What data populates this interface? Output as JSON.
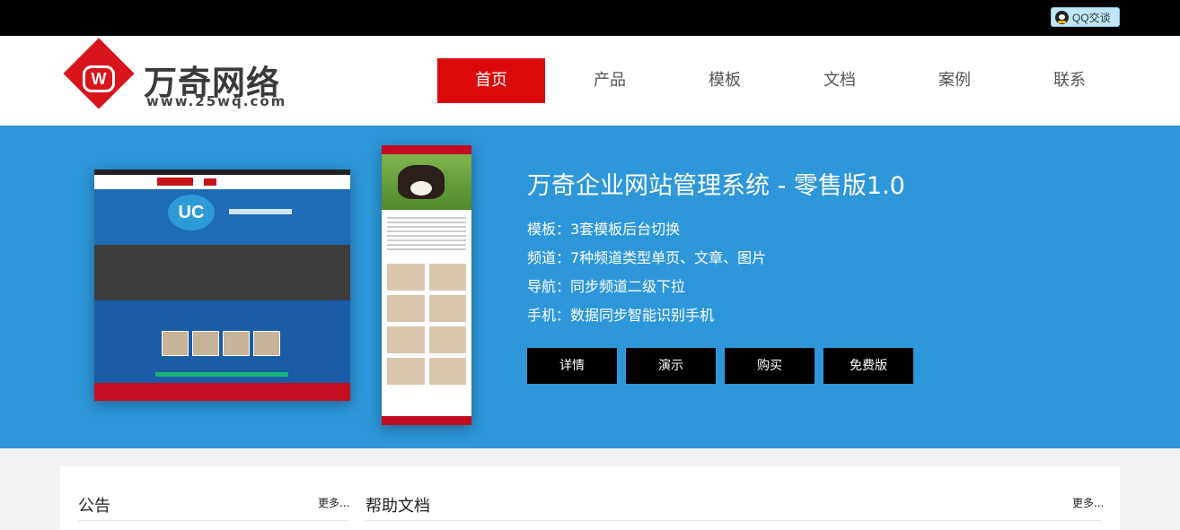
{
  "topbar": {
    "qq_label": "QQ交谈"
  },
  "logo": {
    "mark": "W",
    "title": "万奇网络",
    "url": "www.25wq.com"
  },
  "nav": {
    "items": [
      {
        "label": "首页",
        "active": true
      },
      {
        "label": "产品",
        "active": false
      },
      {
        "label": "模板",
        "active": false
      },
      {
        "label": "文档",
        "active": false
      },
      {
        "label": "案例",
        "active": false
      },
      {
        "label": "联系",
        "active": false
      }
    ]
  },
  "banner": {
    "title": "万奇企业网站管理系统 - 零售版1.0",
    "features": [
      "模板：3套模板后台切换",
      "频道：7种频道类型单页、文章、图片",
      "导航：同步频道二级下拉",
      "手机：数据同步智能识别手机"
    ],
    "buttons": [
      "详情",
      "演示",
      "购买",
      "免费版"
    ],
    "desktop_preview_mark": "UC"
  },
  "panels": {
    "notice": {
      "title": "公告",
      "more": "更多..."
    },
    "help": {
      "title": "帮助文档",
      "more": "更多..."
    }
  },
  "colors": {
    "accent": "#db0a0a",
    "banner": "#2e97d9",
    "topbar": "#000000"
  }
}
